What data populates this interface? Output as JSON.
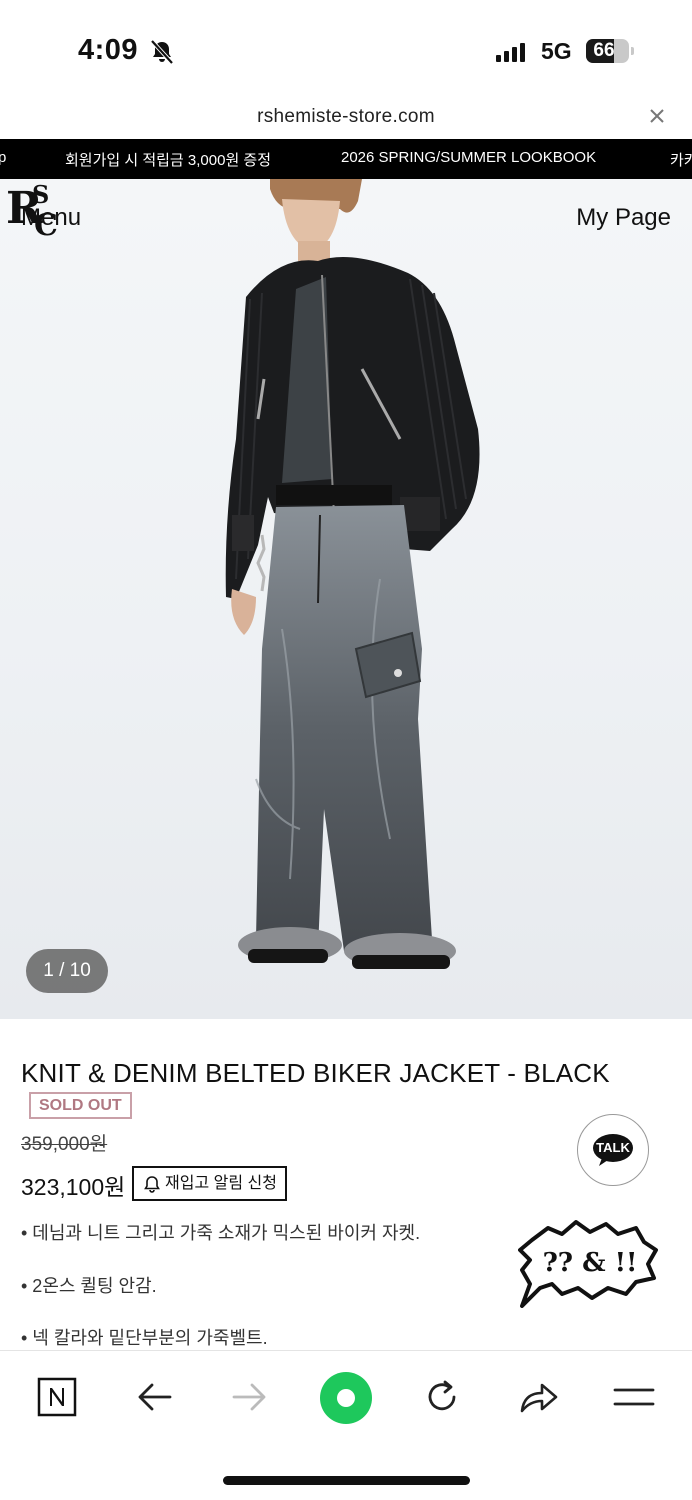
{
  "status_bar": {
    "time": "4:09",
    "network": "5G",
    "battery": "66",
    "battery_level": 0.66,
    "icons": [
      "bell-muted-icon",
      "signal-icon",
      "battery-icon"
    ]
  },
  "browser": {
    "url": "rshemiste-store.com"
  },
  "ticker": {
    "items": [
      "p",
      "회원가입 시 적립금 3,000원 증정",
      "2026 SPRING/SUMMER LOOKBOOK",
      "카카"
    ]
  },
  "header": {
    "menu_label": "Menu",
    "mypage_label": "My Page",
    "logo_text": "RC"
  },
  "gallery": {
    "counter": "1 / 10",
    "current": 1,
    "total": 10
  },
  "product": {
    "name": "KNIT & DENIM BELTED BIKER JACKET - BLACK",
    "badge": "SOLD OUT",
    "original_price": "359,000원",
    "sale_price": "323,100원",
    "restock_label": "재입고 알림 신청",
    "descriptions": [
      "• 데님과 니트 그리고 가죽 소재가 믹스된 바이커 자켓.",
      "• 2온스 퀼팅 안감.",
      "• 넥 칼라와 밑단부분의 가죽벨트."
    ]
  },
  "floating": {
    "talk_label": "TALK",
    "bubble_text": "?? & !!"
  },
  "toolbar": {
    "icons": [
      "naver-icon",
      "back-arrow-icon",
      "forward-arrow-icon",
      "green-dot-icon",
      "reload-icon",
      "share-icon",
      "hamburger-icon"
    ]
  },
  "colors": {
    "ticker_bg": "#000000",
    "soldout": "#b07882",
    "green": "#1ec85c"
  }
}
